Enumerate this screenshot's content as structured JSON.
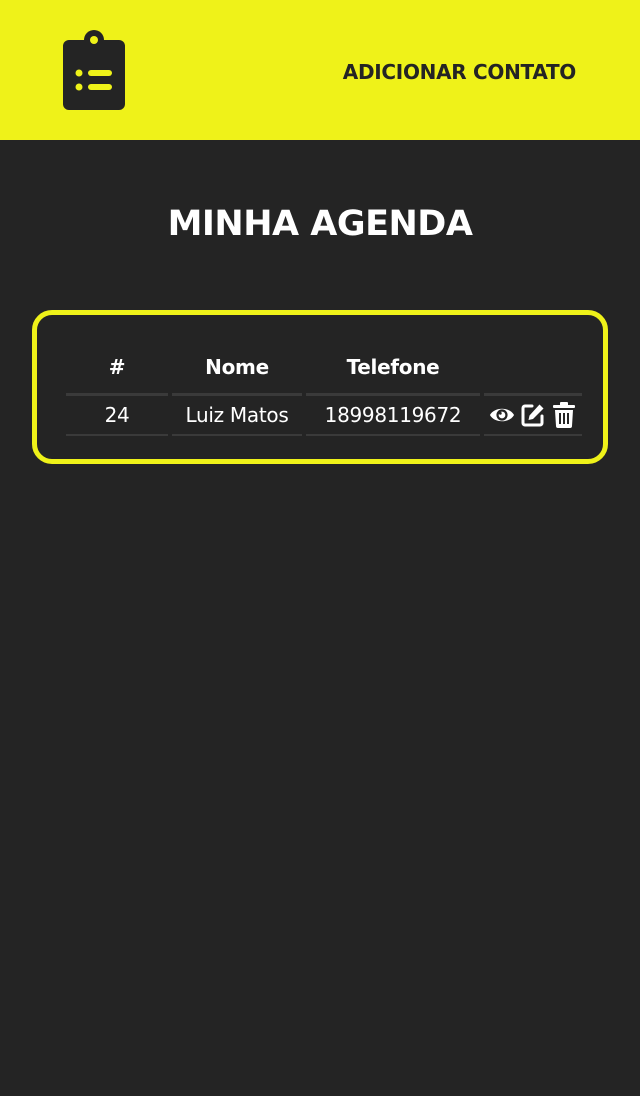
{
  "header": {
    "logo_icon": "clipboard-list-icon",
    "add_contact_label": "ADICIONAR CONTATO",
    "background_color": "#eff219"
  },
  "main": {
    "title": "MINHA AGENDA"
  },
  "table": {
    "columns": [
      "#",
      "Nome",
      "Telefone",
      ""
    ],
    "rows": [
      {
        "id": "24",
        "nome": "Luiz Matos",
        "telefone": "18998119672",
        "actions": [
          "eye-icon",
          "edit-icon",
          "trash-icon"
        ]
      }
    ]
  },
  "colors": {
    "accent": "#eff219",
    "background": "#242424",
    "text": "#ffffff"
  }
}
